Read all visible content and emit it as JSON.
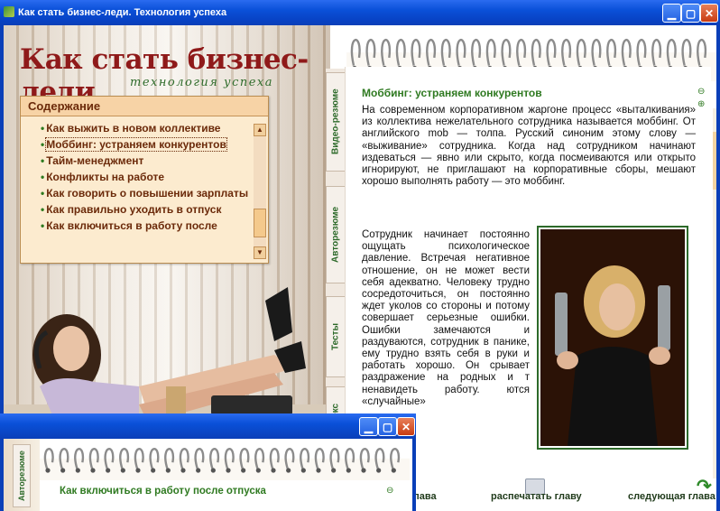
{
  "window": {
    "title": "Как стать бизнес-леди. Технология успеха"
  },
  "logo": {
    "main": "Как стать бизнес-леди",
    "sub": "технология успеха"
  },
  "contents": {
    "header": "Содержание",
    "items": [
      {
        "label": "Как выжить в новом коллективе"
      },
      {
        "label": "Моббинг: устраняем конкурентов"
      },
      {
        "label": "Тайм-менеджмент"
      },
      {
        "label": "Конфликты на работе"
      },
      {
        "label": "Как говорить о повышении зарплаты"
      },
      {
        "label": "Как правильно уходить в отпуск"
      },
      {
        "label": "Как включиться в работу после"
      }
    ]
  },
  "tabs": [
    {
      "label": "Видео-резюме"
    },
    {
      "label": "Авторезюме"
    },
    {
      "label": "Тесты"
    },
    {
      "label": "й кодекс"
    }
  ],
  "article": {
    "title": "Моббинг: устраняем конкурентов",
    "p1": "На современном корпоративном жаргоне процесс «выталкивания» из коллектива нежелательного сотрудника называется моббинг. От английского mob — толпа. Русский синоним этому слову — «выживание» сотрудника. Когда над сотрудником начинают издеваться — явно или скрыто, когда посмеиваются или открыто игнорируют, не приглашают на корпоративные сборы, мешают хорошо выполнять работу — это моббинг.",
    "p2": "Сотрудник начинает постоянно ощущать психологическое давление. Встречая негативное отношение, он не может вести себя адекватно. Человеку трудно сосредоточиться, он постоянно ждет уколов со стороны и потому совершает серьезные ошибки. Ошибки замечаются и раздуваются, сотрудник в панике, ему трудно взять себя в руки и работать хорошо. Он срывает раздражение на родных и т ненавидеть работу. ются «случайные»"
  },
  "bottom": {
    "prev": "я глава",
    "print": "распечатать главу",
    "next": "следующая глава"
  },
  "window2": {
    "tab": "Авторезюме",
    "title": "Как включиться в работу после отпуска"
  },
  "colors": {
    "logo_red": "#8f1a1a",
    "accent_green": "#2f7a21",
    "toc_brown": "#6b2a0a",
    "xp_blue": "#0a3fb8"
  }
}
